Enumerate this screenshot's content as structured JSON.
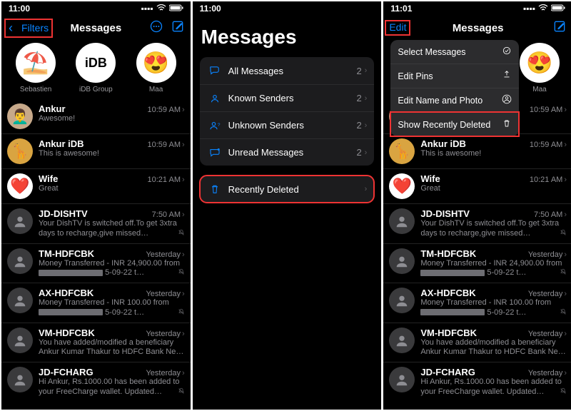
{
  "s1": {
    "time": "11:00",
    "back": "Filters",
    "title": "Messages",
    "pinned": [
      {
        "emoji": "⛱️",
        "label": "Sebastien",
        "bg": "white"
      },
      {
        "text": "iDB",
        "label": "iDB Group",
        "bg": "white"
      },
      {
        "emoji": "😍",
        "label": "Maa",
        "bg": "white"
      }
    ]
  },
  "s2": {
    "time": "11:00",
    "title": "Messages",
    "filters": [
      {
        "icon": "bubbles",
        "label": "All Messages",
        "count": "2"
      },
      {
        "icon": "person",
        "label": "Known Senders",
        "count": "2"
      },
      {
        "icon": "person-q",
        "label": "Unknown Senders",
        "count": "2"
      },
      {
        "icon": "bubble-dot",
        "label": "Unread Messages",
        "count": "2"
      }
    ],
    "deleted_label": "Recently Deleted"
  },
  "s3": {
    "time": "11:01",
    "edit": "Edit",
    "title": "Messages",
    "menu": [
      {
        "label": "Select Messages"
      },
      {
        "label": "Edit Pins"
      },
      {
        "label": "Edit Name and Photo"
      },
      {
        "label": "Show Recently Deleted"
      }
    ],
    "pinned_maa": "Maa"
  },
  "convs": [
    {
      "name": "Ankur",
      "time": "10:59 AM",
      "prev": "Awesome!",
      "avatar": "photo",
      "mute": false
    },
    {
      "name": "Ankur iDB",
      "time": "10:59 AM",
      "prev": "This is awesome!",
      "avatar": "giraffe",
      "mute": false
    },
    {
      "name": "Wife",
      "time": "10:21 AM",
      "prev": "Great",
      "avatar": "heart",
      "mute": false
    },
    {
      "name": "JD-DISHTV",
      "time": "7:50 AM",
      "prev": "Your DishTV is switched off.To get 3xtra days to recharge,give missed…",
      "avatar": "generic",
      "mute": true
    },
    {
      "name": "TM-HDFCBK",
      "time": "Yesterday",
      "prev": "Money Transferred - INR 24,900.00 from",
      "redact_suffix": "5-09-22 t…",
      "avatar": "generic",
      "mute": true
    },
    {
      "name": "AX-HDFCBK",
      "time": "Yesterday",
      "prev": "Money Transferred - INR 100.00 from",
      "redact_suffix": "5-09-22 t…",
      "avatar": "generic",
      "mute": true
    },
    {
      "name": "VM-HDFCBK",
      "time": "Yesterday",
      "prev": "You have added/modified a beneficiary Ankur Kumar Thakur to HDFC Bank Ne…",
      "avatar": "generic",
      "mute": true
    },
    {
      "name": "JD-FCHARG",
      "time": "Yesterday",
      "prev": "Hi Ankur, Rs.1000.00 has been added to your FreeCharge wallet. Updated…",
      "avatar": "generic",
      "mute": true
    }
  ]
}
